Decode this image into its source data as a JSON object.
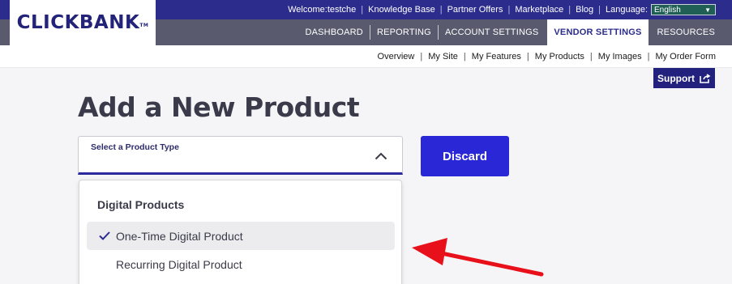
{
  "topbar": {
    "welcome": "Welcome:testche",
    "links": [
      "Knowledge Base",
      "Partner Offers",
      "Marketplace",
      "Blog"
    ],
    "language_label": "Language:",
    "language_value": "English"
  },
  "logo": {
    "text_part1": "CLICK",
    "text_part2": "BANK",
    "tm": "TM"
  },
  "main_nav": {
    "tabs": [
      "DASHBOARD",
      "REPORTING",
      "ACCOUNT SETTINGS",
      "VENDOR SETTINGS",
      "RESOURCES"
    ],
    "active": "VENDOR SETTINGS"
  },
  "sub_nav": {
    "items": [
      "Overview",
      "My Site",
      "My Features",
      "My Products",
      "My Images",
      "My Order Form"
    ]
  },
  "support_label": "Support",
  "page_title": "Add a New Product",
  "product_type": {
    "label": "Select a Product Type",
    "value": ""
  },
  "discard_label": "Discard",
  "dropdown": {
    "group_label": "Digital Products",
    "options": [
      {
        "label": "One-Time Digital Product",
        "selected": true
      },
      {
        "label": "Recurring Digital Product",
        "selected": false
      }
    ]
  },
  "colors": {
    "brand_navy": "#2c2c8c",
    "nav_gray": "#5a5a6e",
    "accent_blue": "#2a28d6",
    "annotation_red": "#e8101a"
  }
}
